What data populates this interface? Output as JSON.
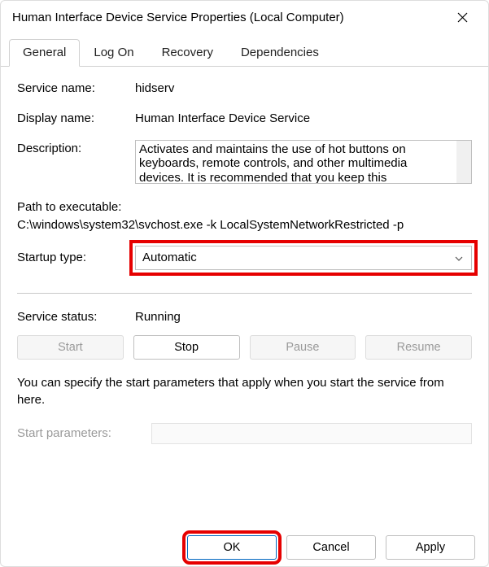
{
  "window": {
    "title": "Human Interface Device Service Properties (Local Computer)"
  },
  "tabs": [
    {
      "label": "General",
      "active": true
    },
    {
      "label": "Log On",
      "active": false
    },
    {
      "label": "Recovery",
      "active": false
    },
    {
      "label": "Dependencies",
      "active": false
    }
  ],
  "fields": {
    "service_name_label": "Service name:",
    "service_name_value": "hidserv",
    "display_name_label": "Display name:",
    "display_name_value": "Human Interface Device Service",
    "description_label": "Description:",
    "description_value": "Activates and maintains the use of hot buttons on keyboards, remote controls, and other multimedia devices. It is recommended that you keep this",
    "path_label": "Path to executable:",
    "path_value": "C:\\windows\\system32\\svchost.exe -k LocalSystemNetworkRestricted -p",
    "startup_label": "Startup type:",
    "startup_value": "Automatic",
    "status_label": "Service status:",
    "status_value": "Running",
    "hint": "You can specify the start parameters that apply when you start the service from here.",
    "params_label": "Start parameters:",
    "params_value": ""
  },
  "buttons": {
    "start": "Start",
    "stop": "Stop",
    "pause": "Pause",
    "resume": "Resume",
    "ok": "OK",
    "cancel": "Cancel",
    "apply": "Apply"
  }
}
